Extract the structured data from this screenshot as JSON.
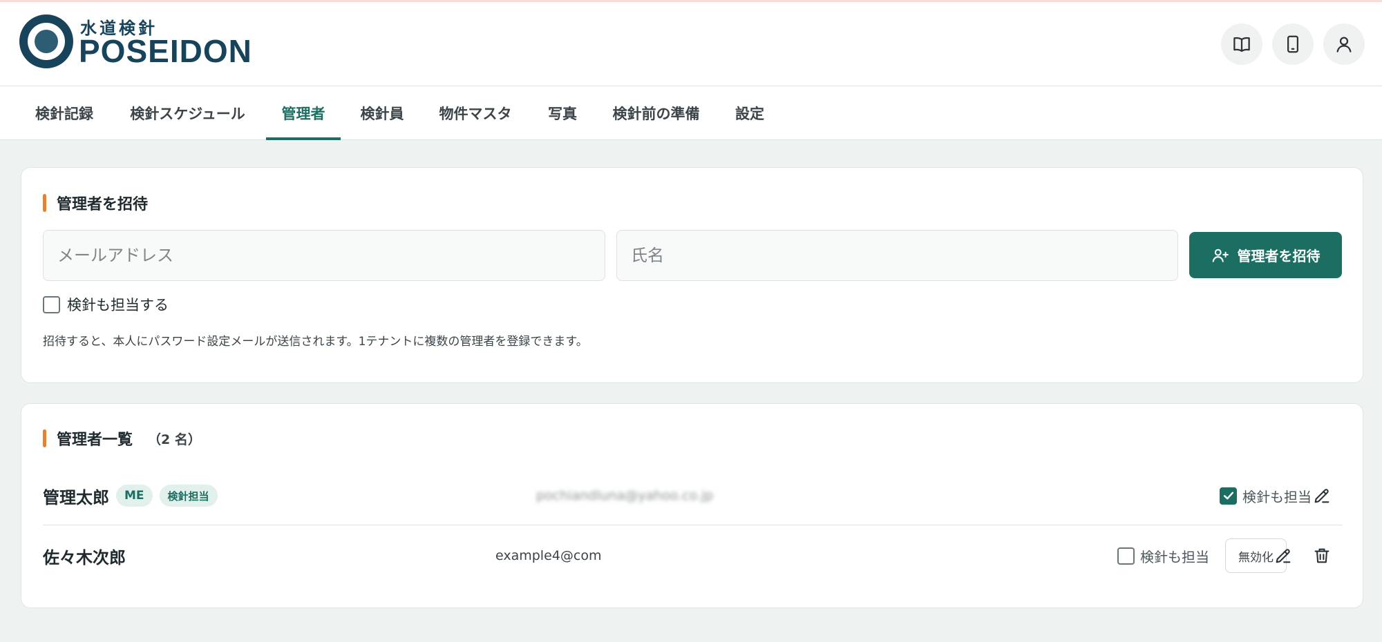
{
  "header": {
    "logo_sub": "水道検針",
    "logo_main": "POSEIDON",
    "icons": [
      "book-icon",
      "tablet-icon",
      "user-icon"
    ]
  },
  "tabs": [
    {
      "label": "検針記録",
      "active": false
    },
    {
      "label": "検針スケジュール",
      "active": false
    },
    {
      "label": "管理者",
      "active": true
    },
    {
      "label": "検針員",
      "active": false
    },
    {
      "label": "物件マスタ",
      "active": false
    },
    {
      "label": "写真",
      "active": false
    },
    {
      "label": "検針前の準備",
      "active": false
    },
    {
      "label": "設定",
      "active": false
    }
  ],
  "invite": {
    "title": "管理者を招待",
    "email_placeholder": "メールアドレス",
    "name_placeholder": "氏名",
    "email_value": "",
    "name_value": "",
    "button_label": "管理者を招待",
    "checkbox_label": "検針も担当する",
    "checkbox_checked": false,
    "note": "招待すると、本人にパスワード設定メールが送信されます。1テナントに複数の管理者を登録できます。"
  },
  "admin_list": {
    "title": "管理者一覧",
    "count_label": "（2 名）",
    "rows": [
      {
        "name": "管理太郎",
        "badges": [
          "ME",
          "検針担当"
        ],
        "email": "pochiandluna@yahoo.co.jp",
        "checkbox_label": "検針も担当",
        "checked": true
      },
      {
        "name": "佐々木次郎",
        "badges": [],
        "email": "example4@com",
        "checkbox_label": "検針も担当",
        "checked": false,
        "disable_label": "無効化"
      }
    ]
  },
  "colors": {
    "accent": "#1c6d62",
    "brand": "#17445a",
    "title_bar": "#e0823a",
    "background": "#eef2f1"
  }
}
